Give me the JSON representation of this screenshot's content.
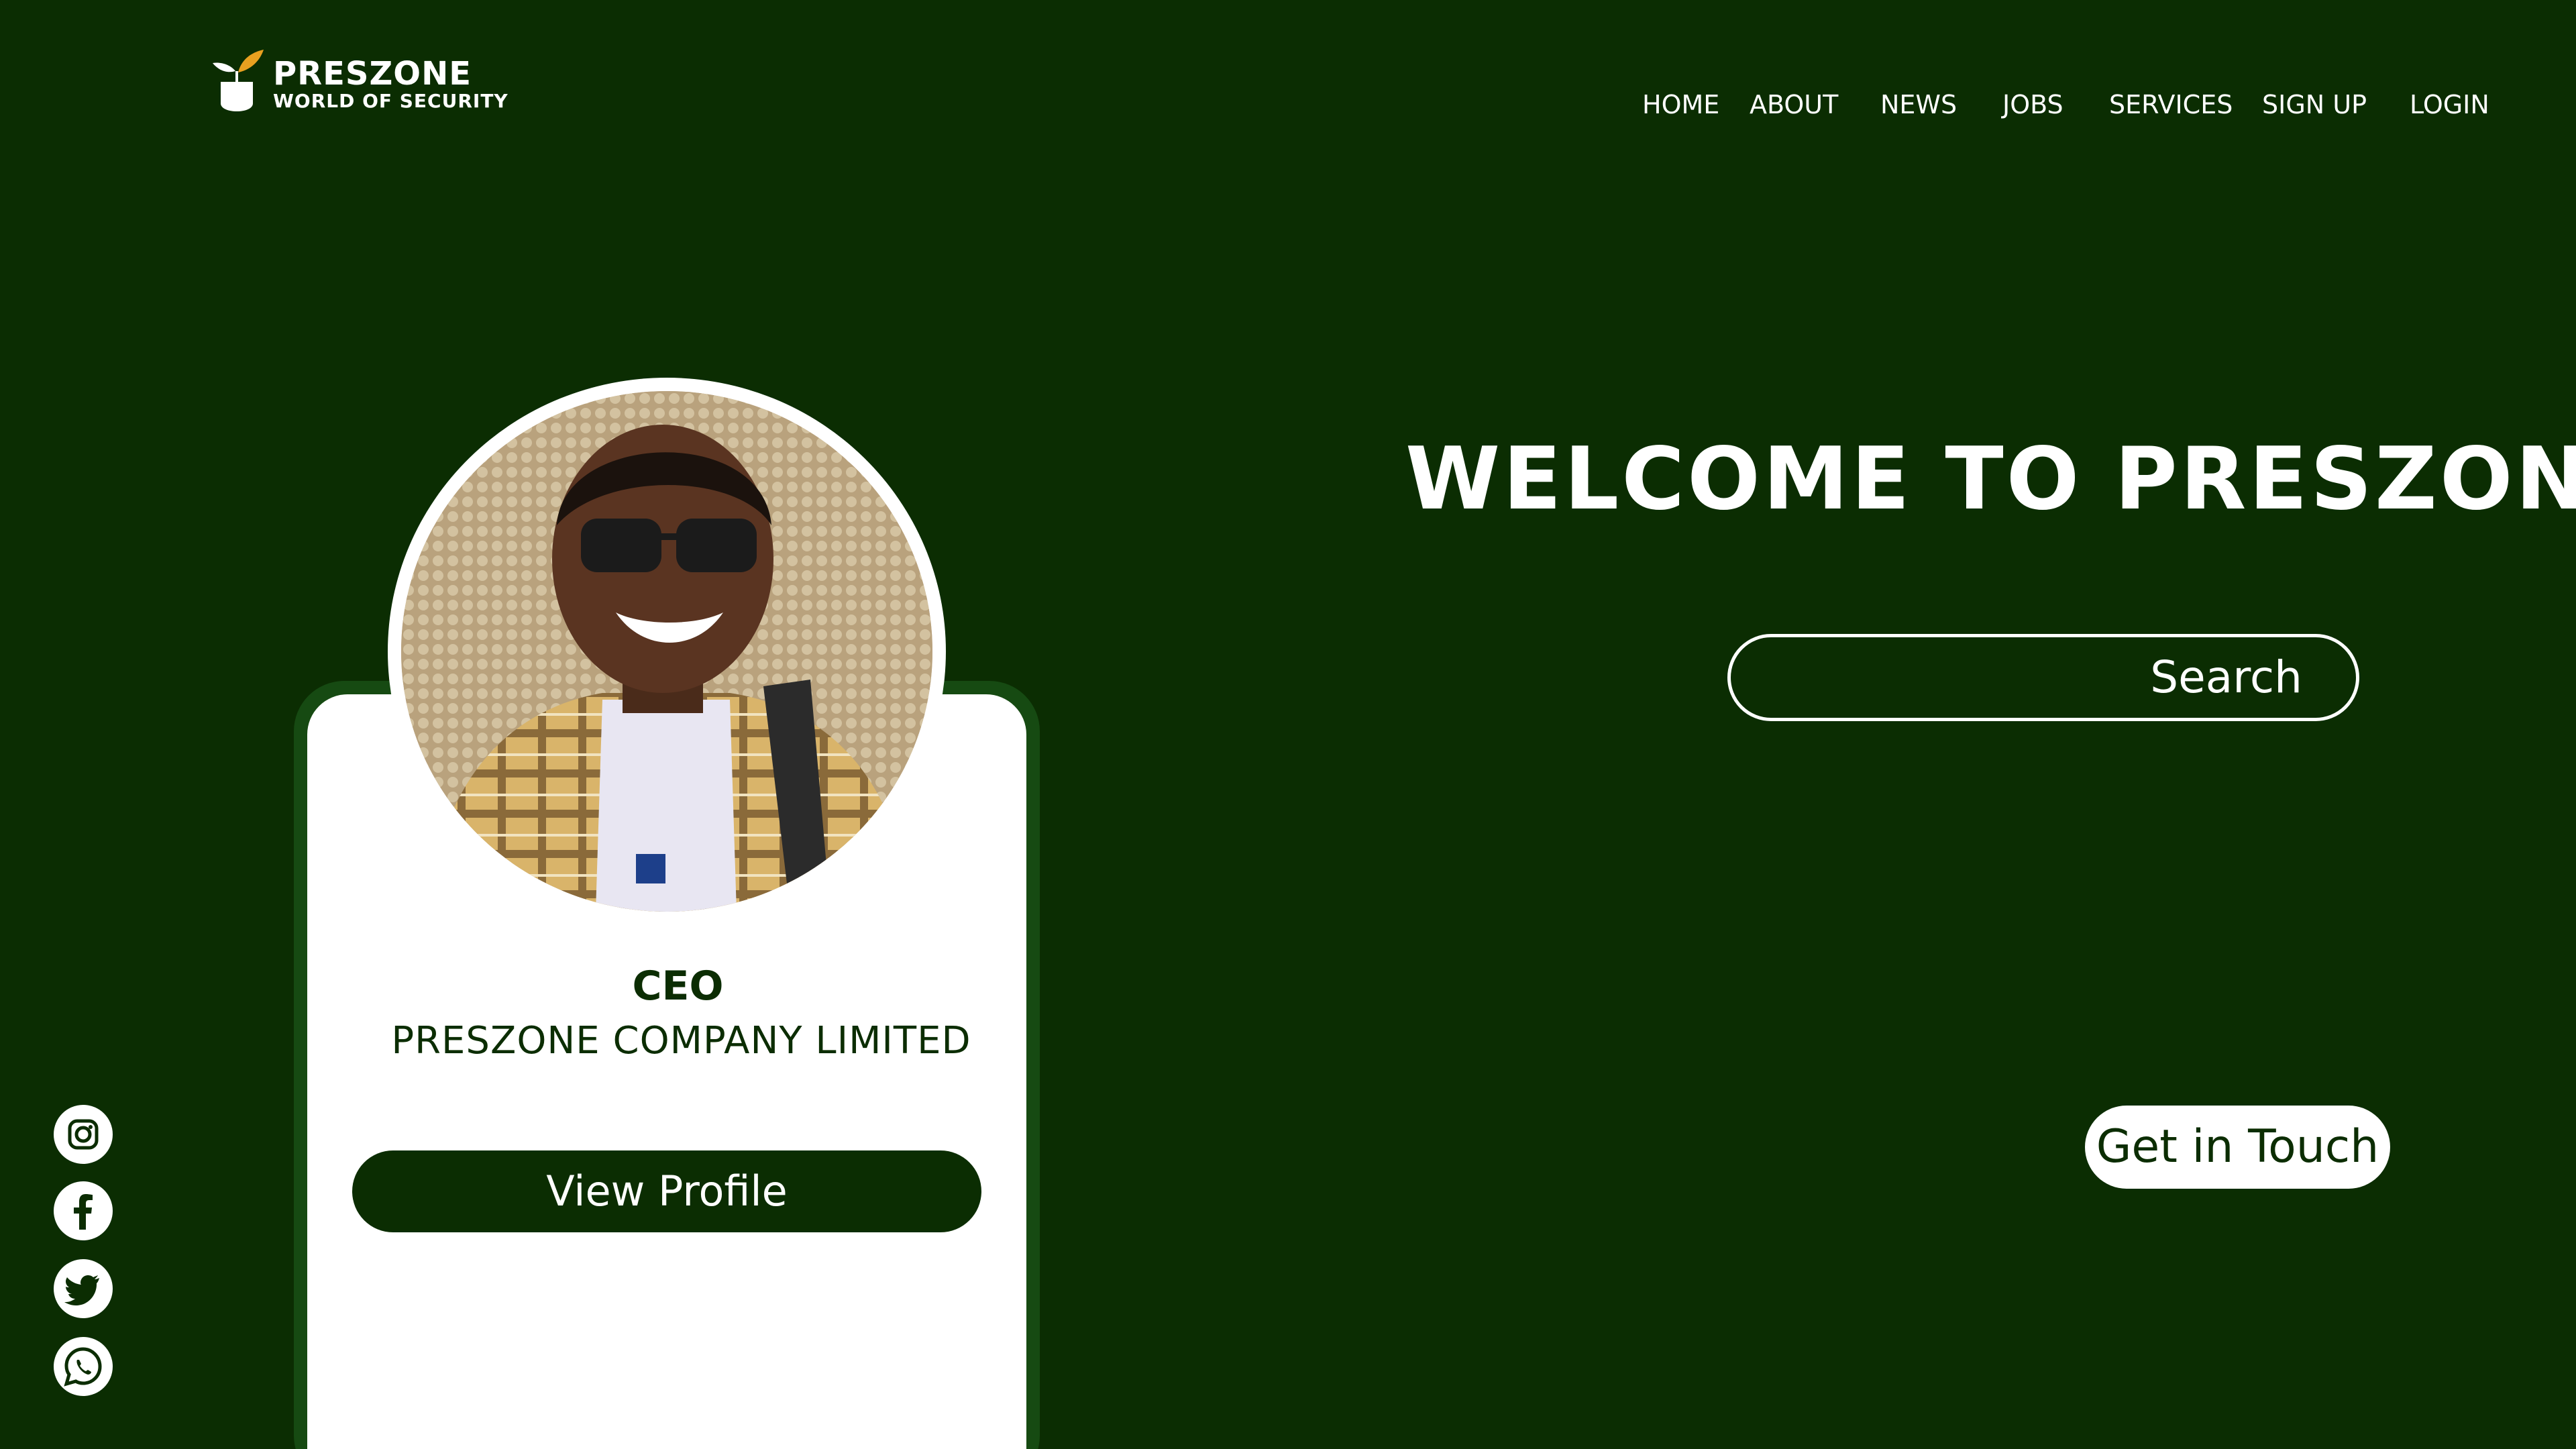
{
  "brand": {
    "name": "PRESZONE",
    "tagline": "WORLD OF SECURITY",
    "accent_color": "#e8a020",
    "background_color": "#0b2d02"
  },
  "nav": {
    "items": [
      {
        "label": "HOME"
      },
      {
        "label": "ABOUT"
      },
      {
        "label": "NEWS"
      },
      {
        "label": "JOBS"
      },
      {
        "label": "SERVICES"
      },
      {
        "label": "SIGN UP"
      },
      {
        "label": "LOGIN"
      }
    ]
  },
  "hero": {
    "title": "WELCOME TO PRESZONE",
    "search": {
      "value": "",
      "button_label": "Search"
    },
    "cta_label": "Get in Touch"
  },
  "profile_card": {
    "role": "CEO",
    "company": "PRESZONE COMPANY LIMITED",
    "button_label": "View Profile"
  },
  "social": {
    "icons": [
      "instagram-icon",
      "facebook-icon",
      "twitter-icon",
      "whatsapp-icon"
    ]
  }
}
